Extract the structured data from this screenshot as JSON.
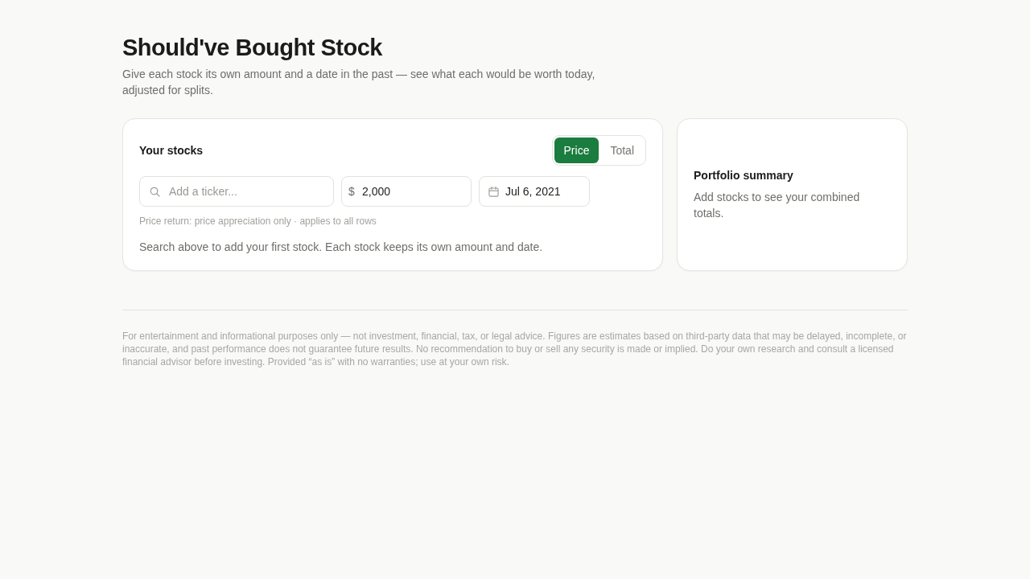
{
  "header": {
    "title": "Should've Bought Stock",
    "subtitle": "Give each stock its own amount and a date in the past — see what each would be worth today, adjusted for splits."
  },
  "stocks_panel": {
    "title": "Your stocks",
    "return_toggle": [
      {
        "label": "Price",
        "selected": true
      },
      {
        "label": "Total",
        "selected": false
      }
    ],
    "ticker_field": {
      "placeholder": "Add a ticker..."
    },
    "amount_field": {
      "currency": "$",
      "value": "2,000"
    },
    "date_field": {
      "value": "Jul 6, 2021"
    },
    "note": "Price return: price appreciation only · applies to all rows",
    "empty_message": "Search above to add your first stock. Each stock keeps its own amount and date."
  },
  "summary_panel": {
    "title": "Portfolio summary",
    "message": "Add stocks to see your combined totals."
  },
  "disclaimer": "For entertainment and informational purposes only — not investment, financial, tax, or legal advice. Figures are estimates based on third-party data that may be delayed, incomplete, or inaccurate, and past performance does not guarantee future results. No recommendation to buy or sell any security is made or implied. Do your own research and consult a licensed financial advisor before investing. Provided “as is” with no warranties; use at your own risk."
}
